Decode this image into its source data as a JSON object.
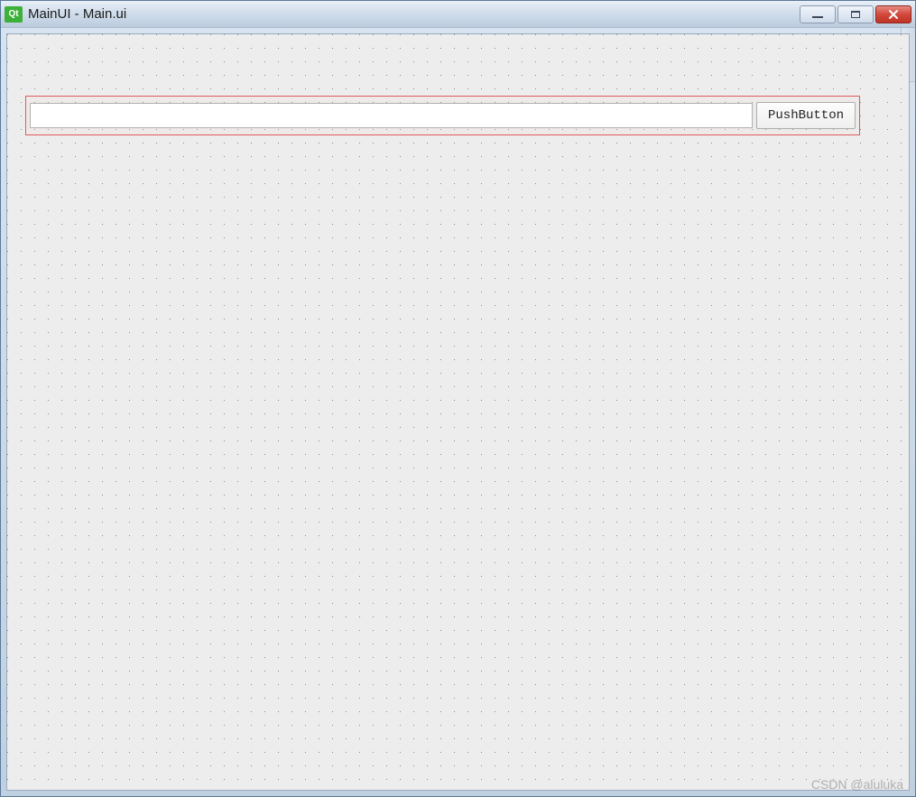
{
  "window": {
    "title": "MainUI - Main.ui",
    "app_icon_label": "Qt"
  },
  "form": {
    "line_edit_value": "",
    "push_button_label": "PushButton"
  },
  "watermark": "CSDN @aluluka"
}
